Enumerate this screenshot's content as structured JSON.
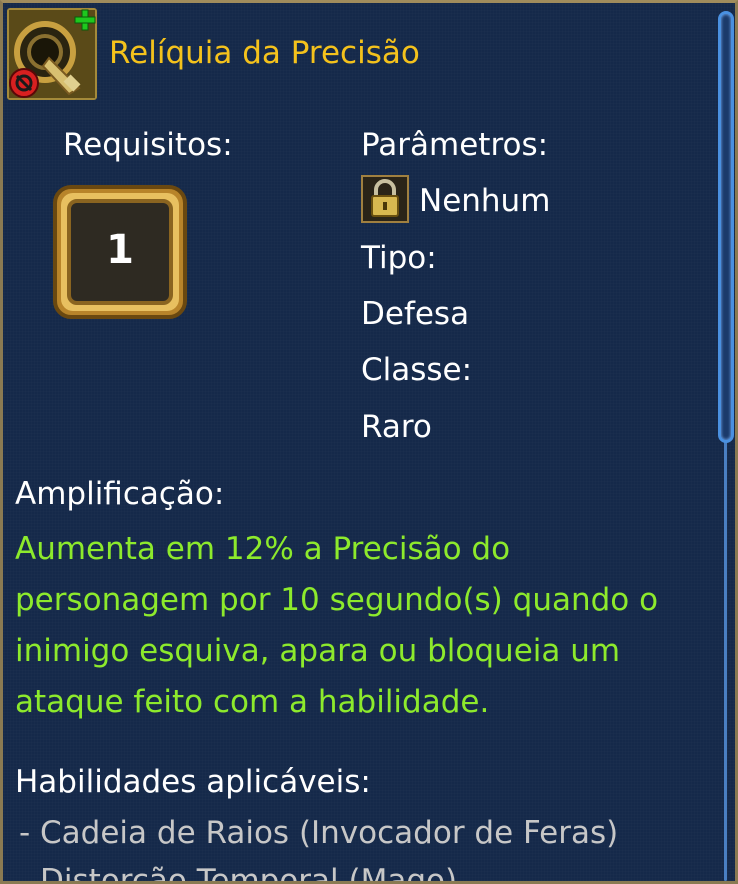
{
  "item": {
    "title": "Relíquia da Precisão",
    "icon": "relic-icon",
    "title_color": "#f4c21c"
  },
  "requirements": {
    "label": "Requisitos:",
    "level": "1"
  },
  "parameters": {
    "label": "Parâmetros:",
    "value": "Nenhum",
    "value_icon": "lock-icon"
  },
  "type": {
    "label": "Tipo:",
    "value": "Defesa"
  },
  "class": {
    "label": "Classe:",
    "value": "Raro"
  },
  "amplification": {
    "label": "Amplificação:",
    "lines": [
      "Aumenta em 12% a Precisão do",
      "personagem por 10 segundo(s) quando o",
      "inimigo esquiva, apara ou bloqueia um",
      "ataque feito com a habilidade."
    ],
    "color": "#8dea2c"
  },
  "skills": {
    "label": "Habilidades aplicáveis:",
    "items": [
      "- Cadeia de Raios (Invocador de Feras)",
      "- Distorção Temporal (Mago)"
    ]
  }
}
